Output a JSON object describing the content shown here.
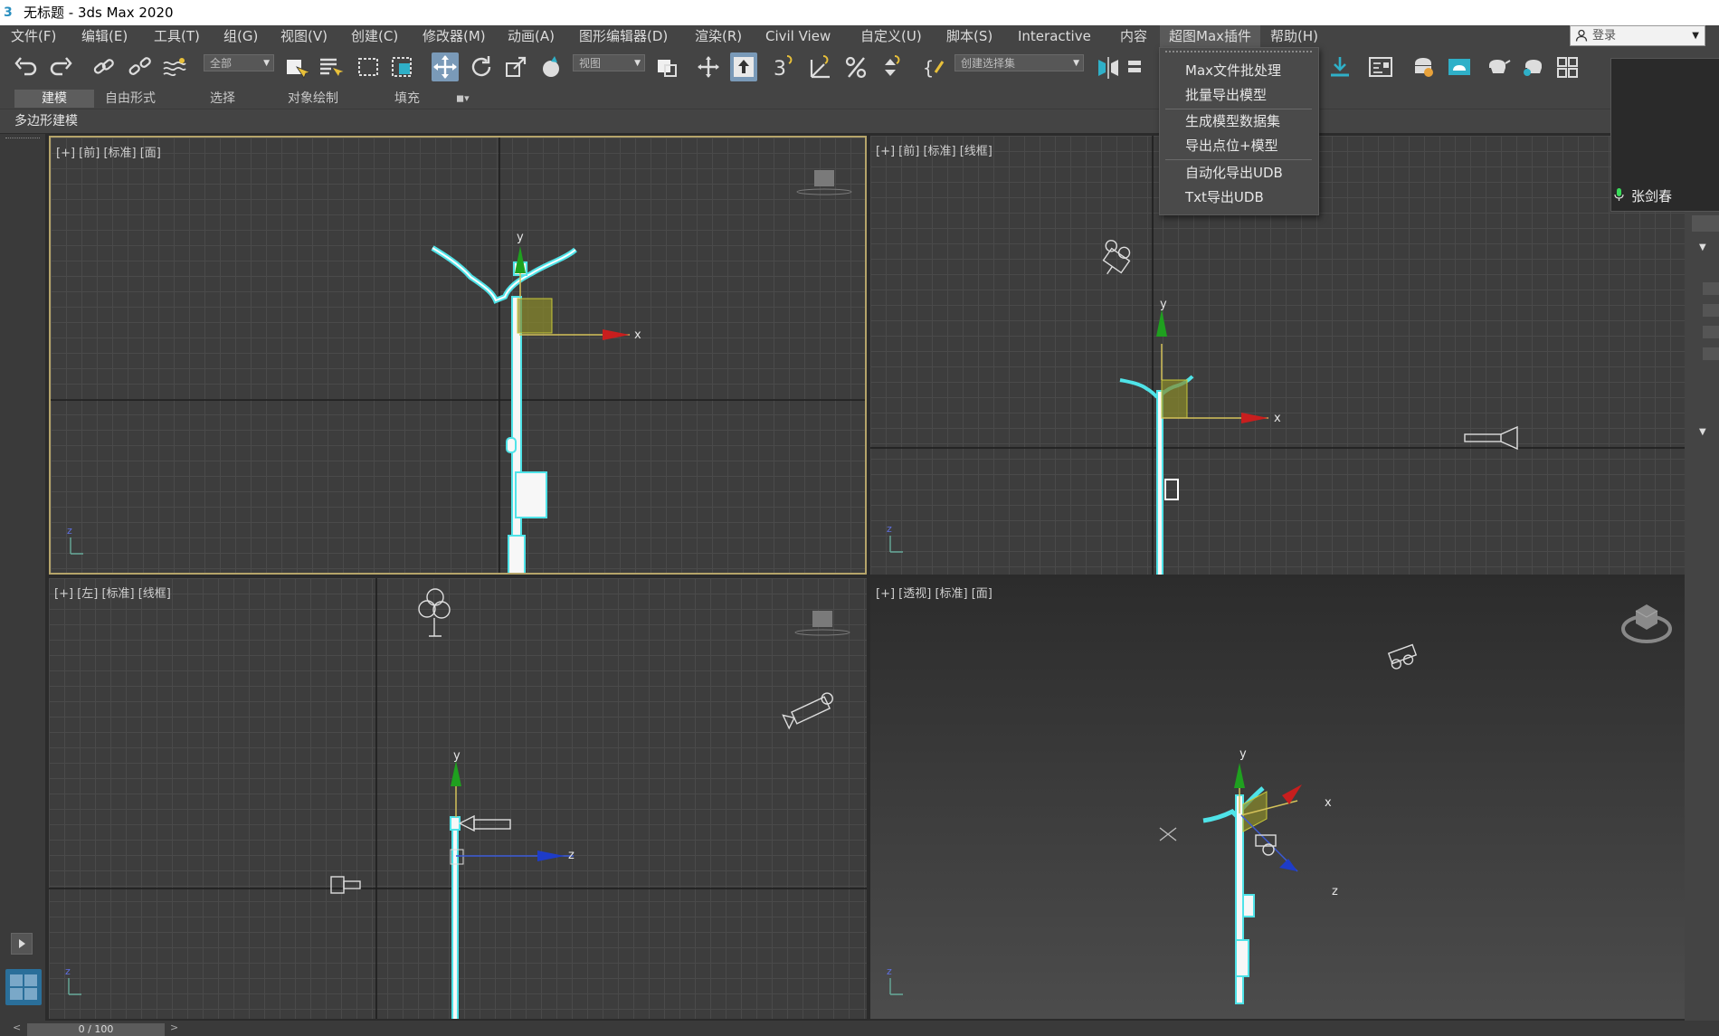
{
  "window": {
    "title": "无标题 - 3ds Max 2020",
    "app_icon": "3"
  },
  "menu": [
    {
      "label": "文件(F)"
    },
    {
      "label": "编辑(E)"
    },
    {
      "label": "工具(T)"
    },
    {
      "label": "组(G)"
    },
    {
      "label": "视图(V)"
    },
    {
      "label": "创建(C)"
    },
    {
      "label": "修改器(M)"
    },
    {
      "label": "动画(A)"
    },
    {
      "label": "图形编辑器(D)"
    },
    {
      "label": "渲染(R)"
    },
    {
      "label": "Civil View"
    },
    {
      "label": "自定义(U)"
    },
    {
      "label": "脚本(S)"
    },
    {
      "label": "Interactive"
    },
    {
      "label": "内容"
    },
    {
      "label": "超图Max插件"
    },
    {
      "label": "帮助(H)"
    }
  ],
  "login": {
    "label": "登录"
  },
  "toolbar": {
    "selection_filter": "全部",
    "reference_coord": "视图",
    "named_selection": "创建选择集",
    "snap_label": "3"
  },
  "ribbon": {
    "tabs": [
      {
        "label": "建模"
      },
      {
        "label": "自由形式"
      },
      {
        "label": "选择"
      },
      {
        "label": "对象绘制"
      },
      {
        "label": "填充"
      }
    ],
    "sub_label": "多边形建模"
  },
  "dropdown": {
    "items": [
      {
        "label": "Max文件批处理"
      },
      {
        "label": "批量导出模型"
      },
      {
        "label": "生成模型数据集"
      },
      {
        "label": "导出点位+模型"
      },
      {
        "label": "自动化导出UDB"
      },
      {
        "label": "Txt导出UDB"
      }
    ]
  },
  "viewports": {
    "front1": {
      "label": "[+] [前] [标准] [面]"
    },
    "front2": {
      "label": "[+] [前] [标准] [线框]"
    },
    "left": {
      "label": "[+] [左] [标准] [线框]"
    },
    "persp": {
      "label": "[+] [透视] [标准] [面]"
    }
  },
  "axes": {
    "x": "x",
    "y": "y",
    "z": "z"
  },
  "preview": {
    "user_name": "张剑春"
  },
  "timeline": {
    "frame": "0 / 100"
  },
  "colors": {
    "selection": "#4fe3e8",
    "x_axis": "#c81e1e",
    "y_axis": "#1fa01f",
    "z_axis": "#1e3cc8",
    "gizmo_plane": "#8a8a2a",
    "active_border": "#b5a46a"
  }
}
